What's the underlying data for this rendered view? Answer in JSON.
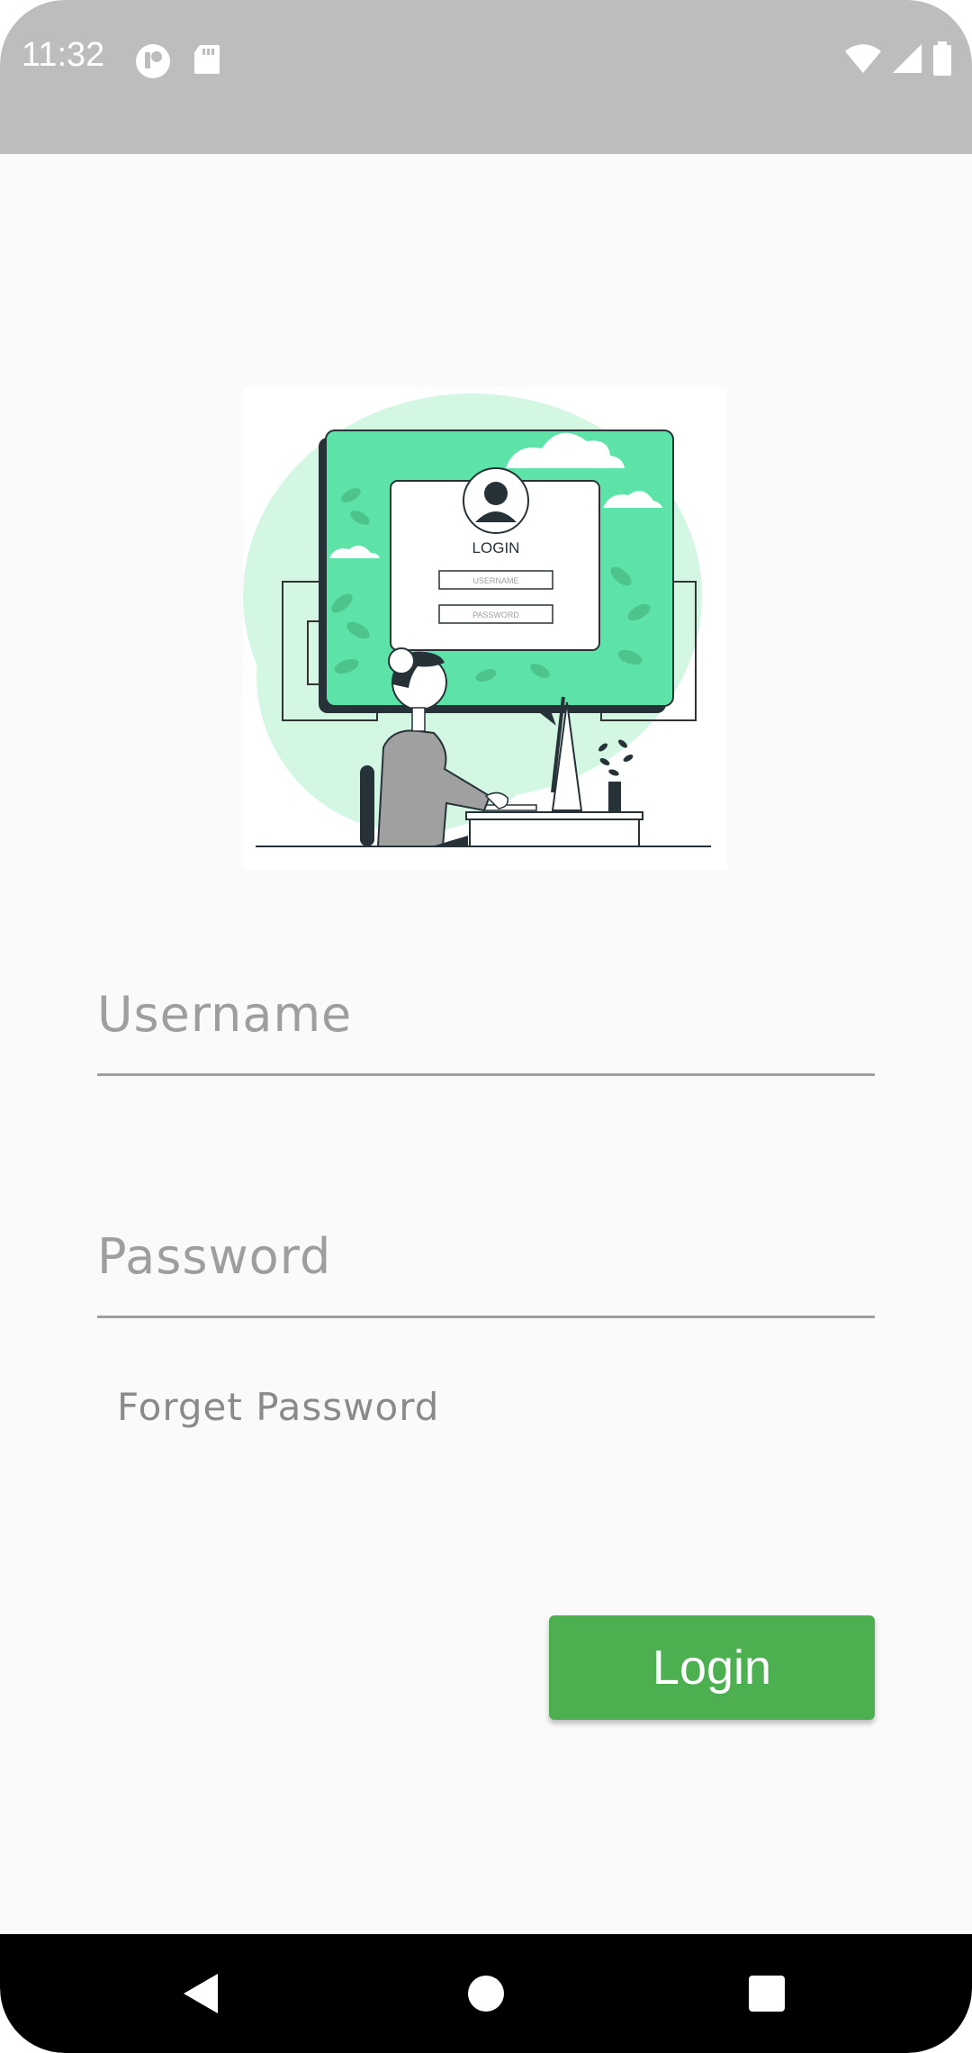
{
  "status_bar": {
    "time": "11:32",
    "left_icons": [
      "media-icon",
      "sd-card-icon"
    ],
    "right_icons": [
      "wifi-icon",
      "signal-icon",
      "battery-icon"
    ]
  },
  "illustration": {
    "title": "LOGIN",
    "field1": "USERNAME",
    "field2": "PASSWORD",
    "accent": "#5de3a8"
  },
  "form": {
    "username_placeholder": "Username",
    "password_placeholder": "Password",
    "forget_label": "Forget Password",
    "login_label": "Login",
    "login_color": "#4caf50"
  },
  "nav_bar": {
    "buttons": [
      "back-icon",
      "home-icon",
      "recents-icon"
    ]
  }
}
